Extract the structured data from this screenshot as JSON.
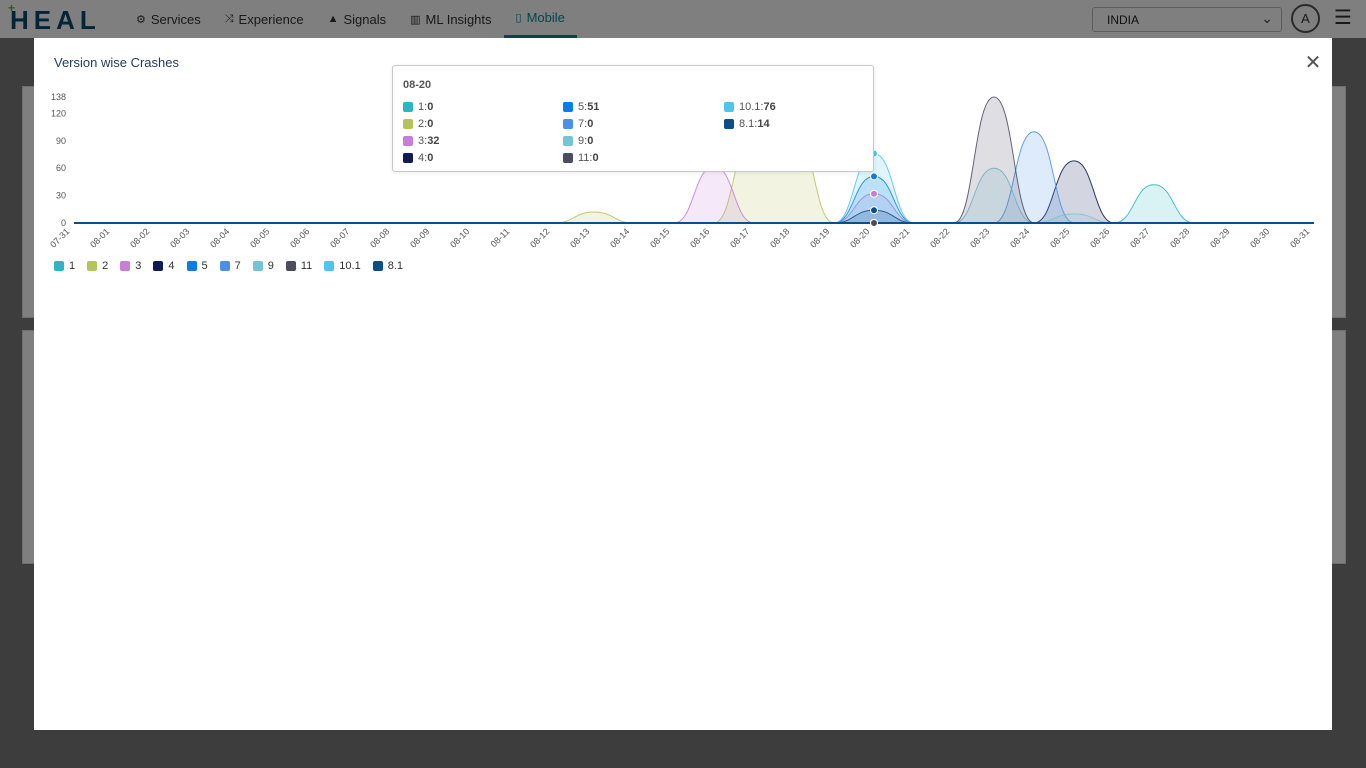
{
  "app": {
    "logo_text": "HEAL",
    "nav": [
      {
        "label": "Services",
        "icon": "gears-icon",
        "glyph": "⚙"
      },
      {
        "label": "Experience",
        "icon": "shuffle-icon",
        "glyph": "⤨"
      },
      {
        "label": "Signals",
        "icon": "warning-icon",
        "glyph": "▲"
      },
      {
        "label": "ML Insights",
        "icon": "bar-chart-icon",
        "glyph": "▥"
      },
      {
        "label": "Mobile",
        "icon": "mobile-icon",
        "glyph": "▯"
      }
    ],
    "country": "INDIA",
    "avatar_initial": "A"
  },
  "modal": {
    "title": "Version wise Crashes",
    "close_glyph": "✕"
  },
  "tooltip": {
    "title": "08-20",
    "items": [
      {
        "name": "1",
        "value": "0"
      },
      {
        "name": "2",
        "value": "0"
      },
      {
        "name": "3",
        "value": "32"
      },
      {
        "name": "4",
        "value": "0"
      },
      {
        "name": "5",
        "value": "51"
      },
      {
        "name": "7",
        "value": "0"
      },
      {
        "name": "9",
        "value": "0"
      },
      {
        "name": "11",
        "value": "0"
      },
      {
        "name": "10.1",
        "value": "76"
      },
      {
        "name": "8.1",
        "value": "14"
      }
    ]
  },
  "chart_data": {
    "type": "area",
    "title": "Version wise Crashes",
    "xlabel": "",
    "ylabel": "",
    "x": [
      "07-31",
      "08-01",
      "08-02",
      "08-03",
      "08-04",
      "08-05",
      "08-06",
      "08-07",
      "08-08",
      "08-09",
      "08-10",
      "08-11",
      "08-12",
      "08-13",
      "08-14",
      "08-15",
      "08-16",
      "08-17",
      "08-18",
      "08-19",
      "08-20",
      "08-21",
      "08-22",
      "08-23",
      "08-24",
      "08-25",
      "08-26",
      "08-27",
      "08-28",
      "08-29",
      "08-30",
      "08-31"
    ],
    "yticks": [
      0,
      30,
      60,
      90,
      120,
      138
    ],
    "ylim": [
      0,
      138
    ],
    "legend_position": "bottom-left",
    "series": [
      {
        "name": "1",
        "color": "#2ab7c2",
        "values": [
          0,
          0,
          0,
          0,
          0,
          0,
          0,
          0,
          0,
          0,
          0,
          0,
          0,
          0,
          0,
          0,
          0,
          0,
          0,
          0,
          0,
          0,
          0,
          0,
          0,
          0,
          0,
          42,
          0,
          0,
          0,
          0
        ]
      },
      {
        "name": "2",
        "color": "#b5c45a",
        "values": [
          0,
          0,
          0,
          0,
          0,
          0,
          0,
          0,
          0,
          0,
          0,
          0,
          0,
          12,
          0,
          0,
          0,
          100,
          100,
          0,
          0,
          0,
          0,
          0,
          0,
          0,
          0,
          0,
          0,
          0,
          0,
          0
        ]
      },
      {
        "name": "3",
        "color": "#c77ed6",
        "values": [
          0,
          0,
          0,
          0,
          0,
          0,
          0,
          0,
          0,
          0,
          0,
          0,
          0,
          0,
          0,
          0,
          62,
          0,
          0,
          0,
          32,
          0,
          0,
          0,
          0,
          0,
          0,
          0,
          0,
          0,
          0,
          0
        ]
      },
      {
        "name": "4",
        "color": "#0d1b57",
        "values": [
          0,
          0,
          0,
          0,
          0,
          0,
          0,
          0,
          0,
          0,
          0,
          0,
          0,
          0,
          0,
          0,
          0,
          0,
          0,
          0,
          0,
          0,
          0,
          0,
          0,
          68,
          0,
          0,
          0,
          0,
          0,
          0
        ]
      },
      {
        "name": "5",
        "color": "#0a7de6",
        "values": [
          0,
          0,
          0,
          0,
          0,
          0,
          0,
          0,
          0,
          0,
          0,
          0,
          0,
          0,
          0,
          0,
          0,
          0,
          0,
          0,
          51,
          0,
          0,
          0,
          0,
          0,
          0,
          0,
          0,
          0,
          0,
          0
        ]
      },
      {
        "name": "7",
        "color": "#4a8fe8",
        "values": [
          0,
          0,
          0,
          0,
          0,
          0,
          0,
          0,
          0,
          0,
          0,
          0,
          0,
          0,
          0,
          0,
          0,
          0,
          0,
          0,
          0,
          0,
          0,
          0,
          100,
          0,
          0,
          0,
          0,
          0,
          0,
          0
        ]
      },
      {
        "name": "9",
        "color": "#73c4d6",
        "values": [
          0,
          0,
          0,
          0,
          0,
          0,
          0,
          0,
          0,
          0,
          0,
          0,
          0,
          0,
          0,
          0,
          0,
          0,
          0,
          0,
          0,
          0,
          0,
          60,
          0,
          10,
          0,
          0,
          0,
          0,
          0,
          0
        ]
      },
      {
        "name": "11",
        "color": "#4b4b63",
        "values": [
          0,
          0,
          0,
          0,
          0,
          0,
          0,
          0,
          0,
          0,
          0,
          0,
          0,
          0,
          0,
          0,
          0,
          0,
          0,
          0,
          0,
          0,
          0,
          138,
          0,
          0,
          0,
          0,
          0,
          0,
          0,
          0
        ]
      },
      {
        "name": "10.1",
        "color": "#4ec4ee",
        "values": [
          0,
          0,
          0,
          0,
          0,
          0,
          0,
          0,
          0,
          0,
          0,
          0,
          0,
          0,
          0,
          0,
          0,
          0,
          0,
          0,
          76,
          0,
          0,
          0,
          0,
          0,
          0,
          0,
          0,
          0,
          0,
          0
        ]
      },
      {
        "name": "8.1",
        "color": "#0a4f8a",
        "values": [
          0,
          0,
          0,
          0,
          0,
          0,
          0,
          0,
          0,
          0,
          0,
          0,
          0,
          0,
          0,
          0,
          0,
          0,
          0,
          0,
          14,
          0,
          0,
          0,
          0,
          0,
          0,
          0,
          0,
          0,
          0,
          0
        ]
      }
    ]
  }
}
